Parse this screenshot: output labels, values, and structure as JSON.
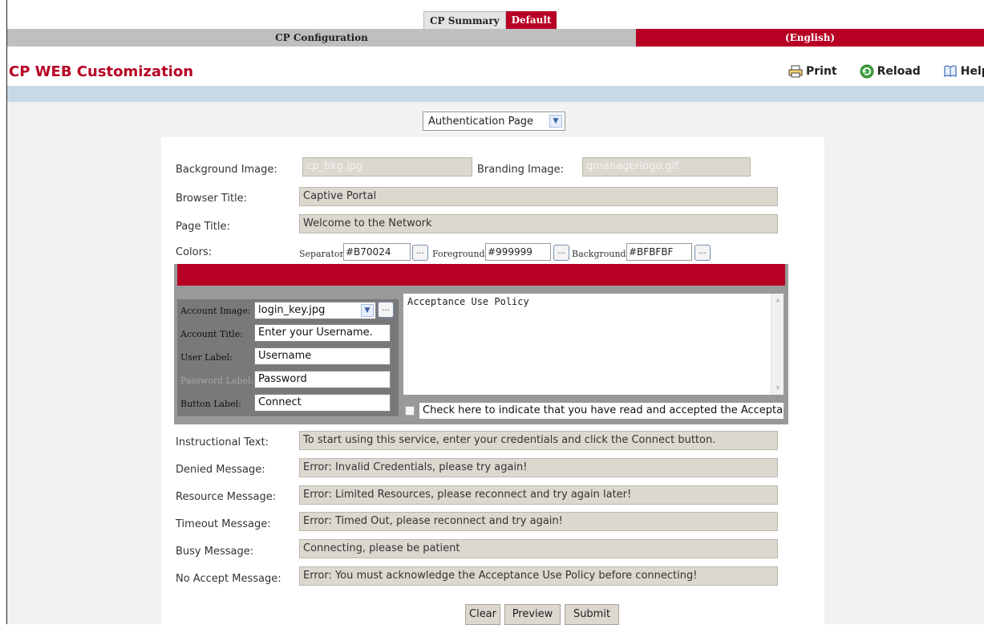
{
  "tabs": {
    "summary": "CP Summary",
    "default": "Default"
  },
  "nav": {
    "left": "CP Configuration",
    "right": "(English)"
  },
  "header": {
    "title": "CP WEB Customization"
  },
  "actions": {
    "print": "Print",
    "reload": "Reload",
    "help": "Help"
  },
  "page_selector": {
    "selected": "Authentication Page"
  },
  "form": {
    "background_image": {
      "label": "Background Image:",
      "value": "cp_bkg.jpg"
    },
    "branding_image": {
      "label": "Branding Image:",
      "value": "qmanagerlogo.gif"
    },
    "browser_title": {
      "label": "Browser Title:",
      "value": "Captive Portal"
    },
    "page_title": {
      "label": "Page Title:",
      "value": "Welcome to the Network"
    },
    "colors": {
      "label": "Colors:",
      "separator_label": "Separator:",
      "separator_value": "#B70024",
      "foreground_label": "Foreground:",
      "foreground_value": "#999999",
      "background_label": "Background:",
      "background_value": "#BFBFBF",
      "dots": "..."
    },
    "preview": {
      "account_image_label": "Account Image:",
      "account_image_value": "login_key.jpg",
      "account_title_label": "Account Title:",
      "account_title_value": "Enter your Username.",
      "user_label_label": "User Label:",
      "user_label_value": "Username",
      "password_label_label": "Password Label:",
      "password_label_value": "Password",
      "button_label_label": "Button Label:",
      "button_label_value": "Connect",
      "aup_text": "Acceptance Use Policy",
      "aup_check": "Check here to indicate that you have read and accepted the Acceptance Use Policy."
    },
    "instructional_text": {
      "label": "Instructional Text:",
      "value": "To start using this service, enter your credentials and click the Connect button."
    },
    "denied_message": {
      "label": "Denied Message:",
      "value": "Error: Invalid Credentials, please try again!"
    },
    "resource_message": {
      "label": "Resource Message:",
      "value": "Error: Limited Resources, please reconnect and try again later!"
    },
    "timeout_message": {
      "label": "Timeout Message:",
      "value": "Error: Timed Out, please reconnect and try again!"
    },
    "busy_message": {
      "label": "Busy Message:",
      "value": "Connecting, please be patient"
    },
    "no_accept_message": {
      "label": "No Accept Message:",
      "value": "Error: You must acknowledge the Acceptance Use Policy before connecting!"
    }
  },
  "buttons": {
    "clear": "Clear",
    "preview": "Preview",
    "submit": "Submit"
  },
  "colors": {
    "accent": "#B70024",
    "separator": "#B70024",
    "foreground": "#999999",
    "background": "#BFBFBF",
    "blue_bar": "#C5D9E8"
  },
  "icons": {
    "print": "printer-icon",
    "reload": "reload-icon",
    "help": "help-book-icon"
  }
}
